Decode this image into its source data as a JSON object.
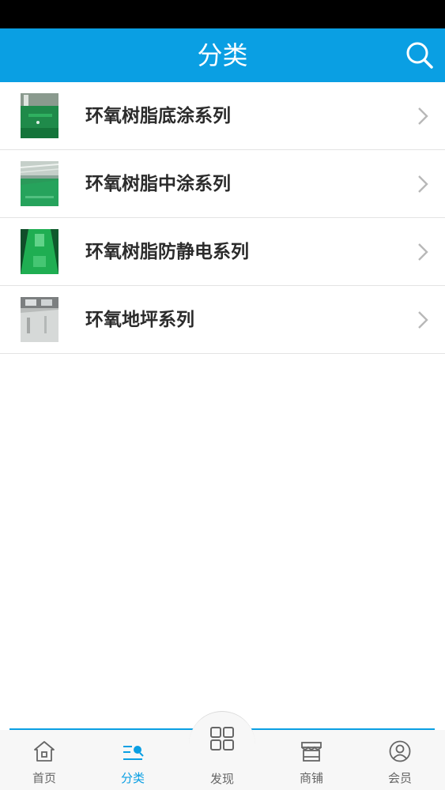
{
  "header": {
    "title": "分类",
    "search_icon": "search-icon"
  },
  "categories": [
    {
      "label": "环氧树脂底涂系列",
      "thumb": "green-floor-photo-1"
    },
    {
      "label": "环氧树脂中涂系列",
      "thumb": "green-floor-photo-2"
    },
    {
      "label": "环氧树脂防静电系列",
      "thumb": "green-floor-photo-3"
    },
    {
      "label": "环氧地坪系列",
      "thumb": "grey-floor-photo"
    }
  ],
  "tabs": [
    {
      "label": "首页",
      "icon": "home-icon"
    },
    {
      "label": "分类",
      "icon": "category-icon",
      "active": true
    },
    {
      "label": "发现",
      "icon": "grid-icon"
    },
    {
      "label": "商铺",
      "icon": "store-icon"
    },
    {
      "label": "会员",
      "icon": "user-icon"
    }
  ],
  "colors": {
    "accent": "#0a9fe3",
    "status_bar": "#000000",
    "tab_bar": "#f7f7f7",
    "text": "#2b2b2b"
  }
}
